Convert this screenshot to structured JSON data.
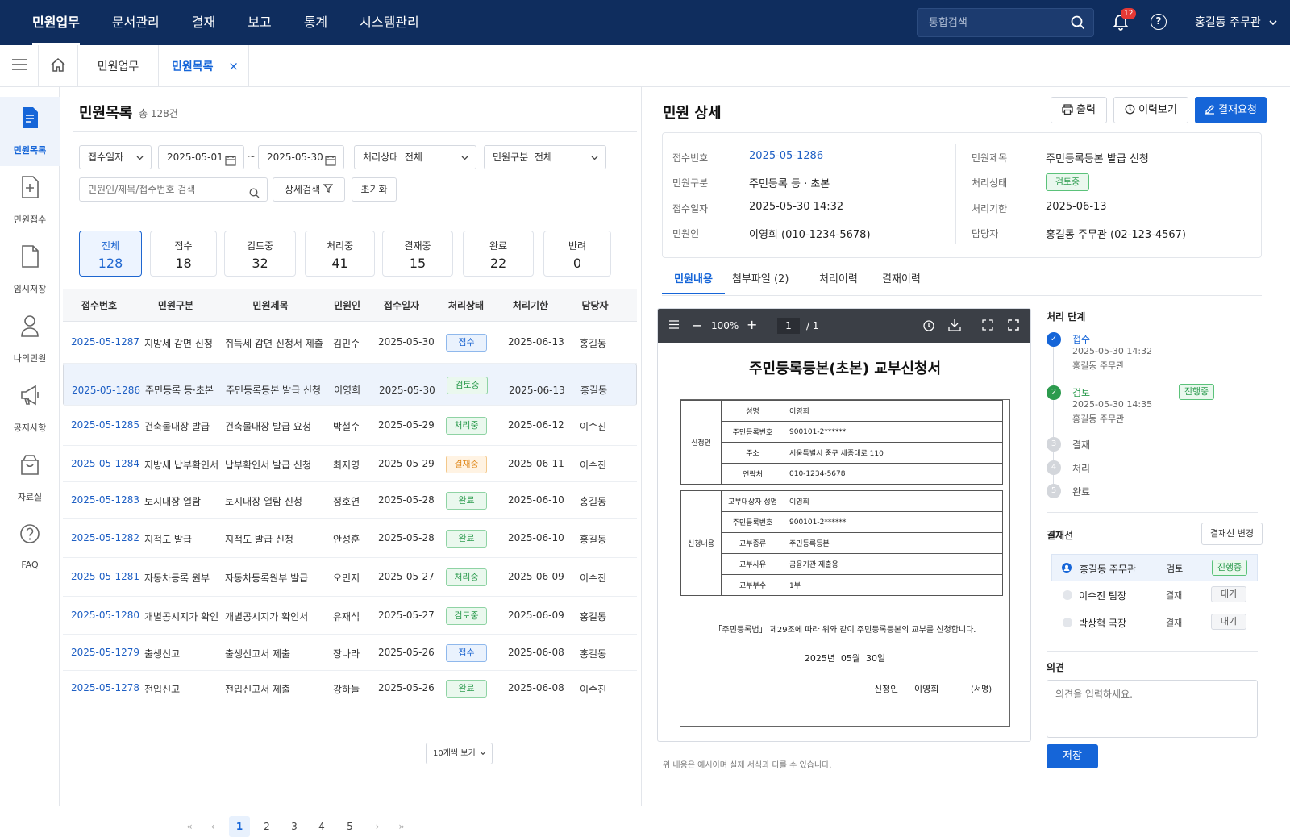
{
  "topnav": {
    "items": [
      "민원업무",
      "문서관리",
      "결재",
      "보고",
      "통계",
      "시스템관리"
    ],
    "search_placeholder": "통합검색",
    "notif_count": "12",
    "user": "홍길동 주무관"
  },
  "tabs": {
    "breadcrumb": "민원업무",
    "active_tab": "민원목록",
    "close": "×"
  },
  "sidebar": {
    "items": [
      {
        "label": "민원목록",
        "icon": "document-list-icon"
      },
      {
        "label": "민원접수",
        "icon": "file-plus-icon"
      },
      {
        "label": "임시저장",
        "icon": "file-icon"
      },
      {
        "label": "나의민원",
        "icon": "person-icon"
      },
      {
        "label": "공지사항",
        "icon": "megaphone-icon"
      },
      {
        "label": "자료실",
        "icon": "box-icon"
      },
      {
        "label": "FAQ",
        "icon": "question-icon"
      }
    ]
  },
  "list": {
    "title": "민원목록",
    "total": "총 128건",
    "filters": {
      "date_type": "접수일자",
      "date_from": "2025-05-01",
      "tilde": "~",
      "date_to": "2025-05-30",
      "status_label": "처리상태",
      "status_value": "전체",
      "type_label": "민원구분",
      "type_value": "전체",
      "search_placeholder": "민원인/제목/접수번호 검색",
      "detail_search": "상세검색",
      "reset": "초기화"
    },
    "stats": [
      {
        "label": "전체",
        "value": "128"
      },
      {
        "label": "접수",
        "value": "18"
      },
      {
        "label": "검토중",
        "value": "32"
      },
      {
        "label": "처리중",
        "value": "41"
      },
      {
        "label": "결재중",
        "value": "15"
      },
      {
        "label": "완료",
        "value": "22"
      },
      {
        "label": "반려",
        "value": "0"
      }
    ],
    "columns": [
      "접수번호",
      "민원구분",
      "민원제목",
      "민원인",
      "접수일자",
      "처리상태",
      "처리기한",
      "담당자"
    ],
    "rows": [
      {
        "id": "2025-05-1287",
        "type": "지방세 감면 신청",
        "title": "취득세 감면 신청서 제출",
        "name": "김민수",
        "date": "2025-05-30",
        "status": "접수",
        "due": "2025-06-13",
        "owner": "홍길동"
      },
      {
        "id": "2025-05-1286",
        "type": "주민등록 등·초본",
        "title": "주민등록등본 발급 신청",
        "name": "이영희",
        "date": "2025-05-30",
        "status": "검토중",
        "due": "2025-06-13",
        "owner": "홍길동"
      },
      {
        "id": "2025-05-1285",
        "type": "건축물대장 발급",
        "title": "건축물대장 발급 요청",
        "name": "박철수",
        "date": "2025-05-29",
        "status": "처리중",
        "due": "2025-06-12",
        "owner": "이수진"
      },
      {
        "id": "2025-05-1284",
        "type": "지방세 납부확인서",
        "title": "납부확인서 발급 신청",
        "name": "최지영",
        "date": "2025-05-29",
        "status": "결재중",
        "due": "2025-06-11",
        "owner": "이수진"
      },
      {
        "id": "2025-05-1283",
        "type": "토지대장 열람",
        "title": "토지대장 열람 신청",
        "name": "정호연",
        "date": "2025-05-28",
        "status": "완료",
        "due": "2025-06-10",
        "owner": "홍길동"
      },
      {
        "id": "2025-05-1282",
        "type": "지적도 발급",
        "title": "지적도 발급 신청",
        "name": "안성훈",
        "date": "2025-05-28",
        "status": "완료",
        "due": "2025-06-10",
        "owner": "홍길동"
      },
      {
        "id": "2025-05-1281",
        "type": "자동차등록 원부",
        "title": "자동차등록원부 발급",
        "name": "오민지",
        "date": "2025-05-27",
        "status": "처리중",
        "due": "2025-06-09",
        "owner": "이수진"
      },
      {
        "id": "2025-05-1280",
        "type": "개별공시지가 확인",
        "title": "개별공시지가 확인서",
        "name": "유재석",
        "date": "2025-05-27",
        "status": "검토중",
        "due": "2025-06-09",
        "owner": "홍길동"
      },
      {
        "id": "2025-05-1279",
        "type": "출생신고",
        "title": "출생신고서 제출",
        "name": "장나라",
        "date": "2025-05-26",
        "status": "접수",
        "due": "2025-06-08",
        "owner": "홍길동"
      },
      {
        "id": "2025-05-1278",
        "type": "전입신고",
        "title": "전입신고서 제출",
        "name": "강하늘",
        "date": "2025-05-26",
        "status": "완료",
        "due": "2025-06-08",
        "owner": "이수진"
      }
    ],
    "pages": [
      "1",
      "2",
      "3",
      "4",
      "5"
    ],
    "page_size": "10개씩 보기"
  },
  "detail": {
    "title": "민원 상세",
    "btn_print": "출력",
    "btn_history": "이력보기",
    "btn_approve": "결재요청",
    "fields": {
      "no_k": "접수번호",
      "no_v": "2025-05-1286",
      "type_k": "민원구분",
      "type_v": "주민등록 등 · 초본",
      "date_k": "접수일자",
      "date_v": "2025-05-30 14:32",
      "person_k": "민원인",
      "person_v": "이영희 (010-1234-5678)",
      "title_k": "민원제목",
      "title_v": "주민등록등본 발급 신청",
      "status_k": "처리상태",
      "status_v": "검토중",
      "due_k": "처리기한",
      "due_v": "2025-06-13",
      "owner_k": "담당자",
      "owner_v": "홍길동 주무관 (02-123-4567)"
    },
    "tabs": [
      "민원내용",
      "첨부파일 (2)",
      "처리이력",
      "결재이력"
    ],
    "viewer": {
      "zoom": "100%",
      "page": "1",
      "page_total": "/ 1"
    },
    "form": {
      "title": "주민등록등본(초본) 교부신청서",
      "applicant_group": "신청인",
      "name_k": "성명",
      "name_v": "이영희",
      "rrn_k": "주민등록번호",
      "rrn_v": "900101-2******",
      "addr_k": "주소",
      "addr_v": "서울특별시 중구 세종대로 110",
      "tel_k": "연락처",
      "tel_v": "010-1234-5678",
      "content_group": "신청내용",
      "target_k": "교부대상자 성명",
      "target_v": "이영희",
      "rrn2_k": "주민등록번호",
      "rrn2_v": "900101-2******",
      "kind_k": "교부종류",
      "kind_v": "주민등록등본",
      "reason_k": "교부사유",
      "reason_v": "금융기관 제출용",
      "count_k": "교부부수",
      "count_v": "1부",
      "statement": "「주민등록법」 제29조에 따라 위와 같이 주민등록등본의 교부를 신청합니다.",
      "date_line": "2025년  05월  30일",
      "signer_label": "신청인",
      "signer_name": "이영희",
      "sign": "(서명)"
    },
    "footnote": "위 내용은 예시이며 실제 서식과 다를 수 있습니다.",
    "steps_title": "처리 단계",
    "steps": [
      {
        "num": "✓",
        "name": "접수",
        "sub1": "2025-05-30 14:32",
        "sub2": "홍길동 주무관"
      },
      {
        "num": "2",
        "name": "검토",
        "sub1": "2025-05-30 14:35",
        "sub2": "홍길동 주무관",
        "badge": "진행중"
      },
      {
        "num": "3",
        "name": "결재"
      },
      {
        "num": "4",
        "name": "처리"
      },
      {
        "num": "5",
        "name": "완료"
      }
    ],
    "approval_title": "결재선",
    "approval_change": "결재선 변경",
    "approvals": [
      {
        "name": "홍길동 주무관",
        "role": "검토",
        "state": "진행중"
      },
      {
        "name": "이수진 팀장",
        "role": "결재",
        "state": "대기"
      },
      {
        "name": "박상혁 국장",
        "role": "결재",
        "state": "대기"
      }
    ],
    "opinion_title": "의견",
    "opinion_placeholder": "의견을 입력하세요.",
    "save": "저장"
  },
  "colors": {
    "navy": "#0f2d5e",
    "accent": "#1565d8",
    "status_접수": "#1e66d0",
    "status_검토중": "#2c9b4e",
    "status_처리중": "#2c9b4e",
    "status_결재중": "#e08a1e",
    "status_완료": "#2c9b4e"
  }
}
